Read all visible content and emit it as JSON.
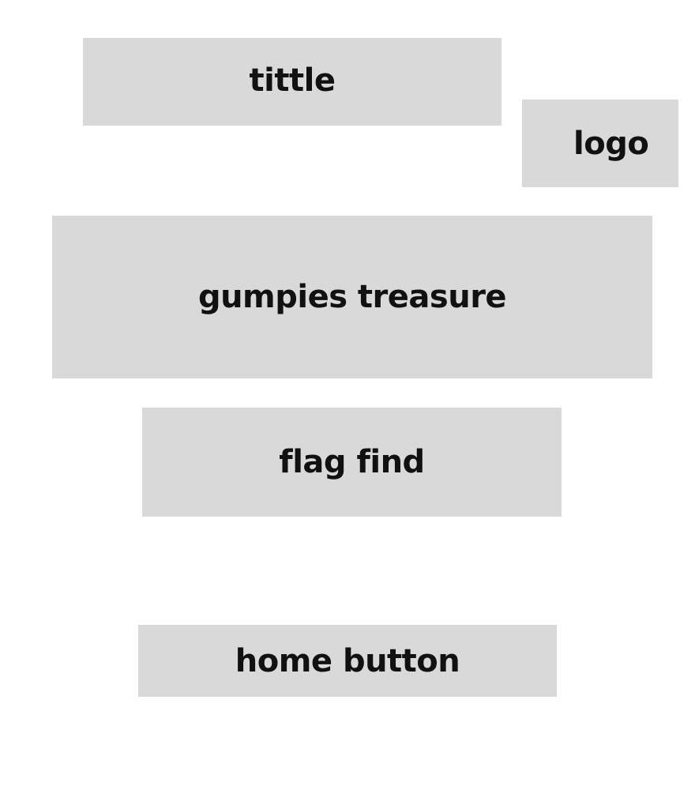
{
  "header": {
    "title": "tittle",
    "logo": "logo"
  },
  "menu": {
    "items": [
      {
        "label": "gumpies treasure"
      },
      {
        "label": "flag find"
      }
    ],
    "home_button": "home button"
  },
  "colors": {
    "background": "#ffffff",
    "box": "#d9d9d9",
    "text": "#111111"
  }
}
